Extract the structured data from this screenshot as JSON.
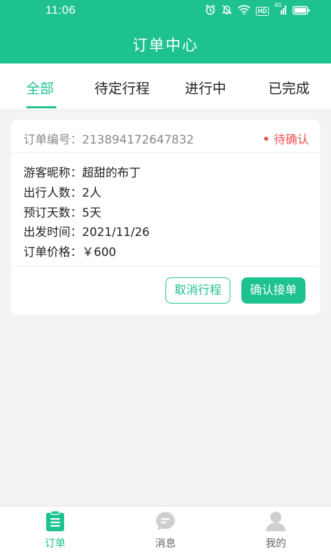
{
  "status_bar": {
    "time": "11:06",
    "icons": [
      "alarm-icon",
      "mute-icon",
      "wifi-icon",
      "hd-icon",
      "signal-icon",
      "battery-icon"
    ],
    "hd_text": "HD",
    "net_text": "4G"
  },
  "header": {
    "title": "订单中心",
    "bg_color": "#1ec28f"
  },
  "tabs": [
    {
      "label": "全部",
      "active": true
    },
    {
      "label": "待定行程",
      "active": false
    },
    {
      "label": "进行中",
      "active": false
    },
    {
      "label": "已完成",
      "active": false
    }
  ],
  "order": {
    "number_label": "订单编号：",
    "number": "213894172647832",
    "status": "待确认",
    "status_color": "#ef5350",
    "fields": [
      {
        "label": "游客昵称：",
        "value": "超甜的布丁"
      },
      {
        "label": "出行人数：",
        "value": "2人"
      },
      {
        "label": "预订天数：",
        "value": "5天"
      },
      {
        "label": "出发时间：",
        "value": "2021/11/26"
      },
      {
        "label": "订单价格：",
        "value": "￥600"
      }
    ],
    "cancel_label": "取消行程",
    "confirm_label": "确认接单"
  },
  "bottom_nav": [
    {
      "label": "订单",
      "icon": "clipboard-icon",
      "active": true
    },
    {
      "label": "消息",
      "icon": "message-icon",
      "active": false
    },
    {
      "label": "我的",
      "icon": "user-icon",
      "active": false
    }
  ],
  "colors": {
    "accent": "#1ec28f",
    "inactive_icon": "#cfcfcf",
    "page_bg": "#f3f3f3"
  }
}
